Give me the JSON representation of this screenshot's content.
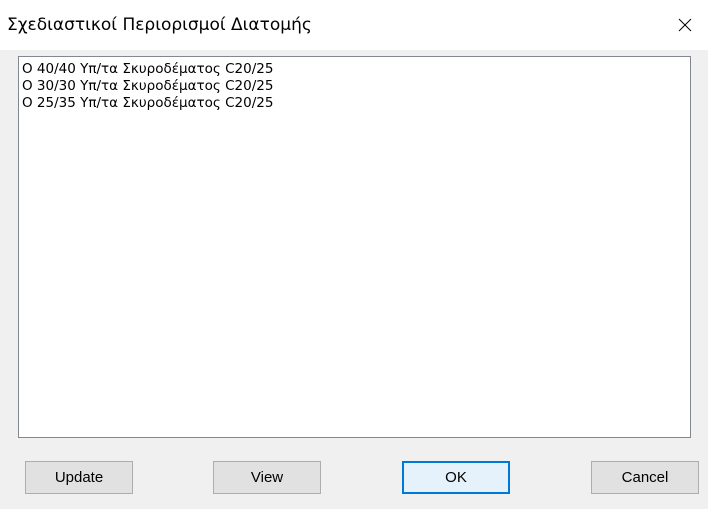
{
  "window": {
    "title": "Σχεδιαστικοί Περιορισμοί Διατομής",
    "close_icon": "close-icon"
  },
  "list": {
    "items": [
      {
        "label": "O 40/40 Υπ/τα Σκυροδέματος C20/25"
      },
      {
        "label": "O 30/30 Υπ/τα Σκυροδέματος C20/25"
      },
      {
        "label": "O 25/35 Υπ/τα Σκυροδέματος C20/25"
      }
    ]
  },
  "buttons": {
    "update": "Update",
    "view": "View",
    "ok": "OK",
    "cancel": "Cancel"
  },
  "colors": {
    "default_button_border": "#0078d7",
    "button_face": "#e1e1e1",
    "window_bg": "#f0f0f0"
  }
}
